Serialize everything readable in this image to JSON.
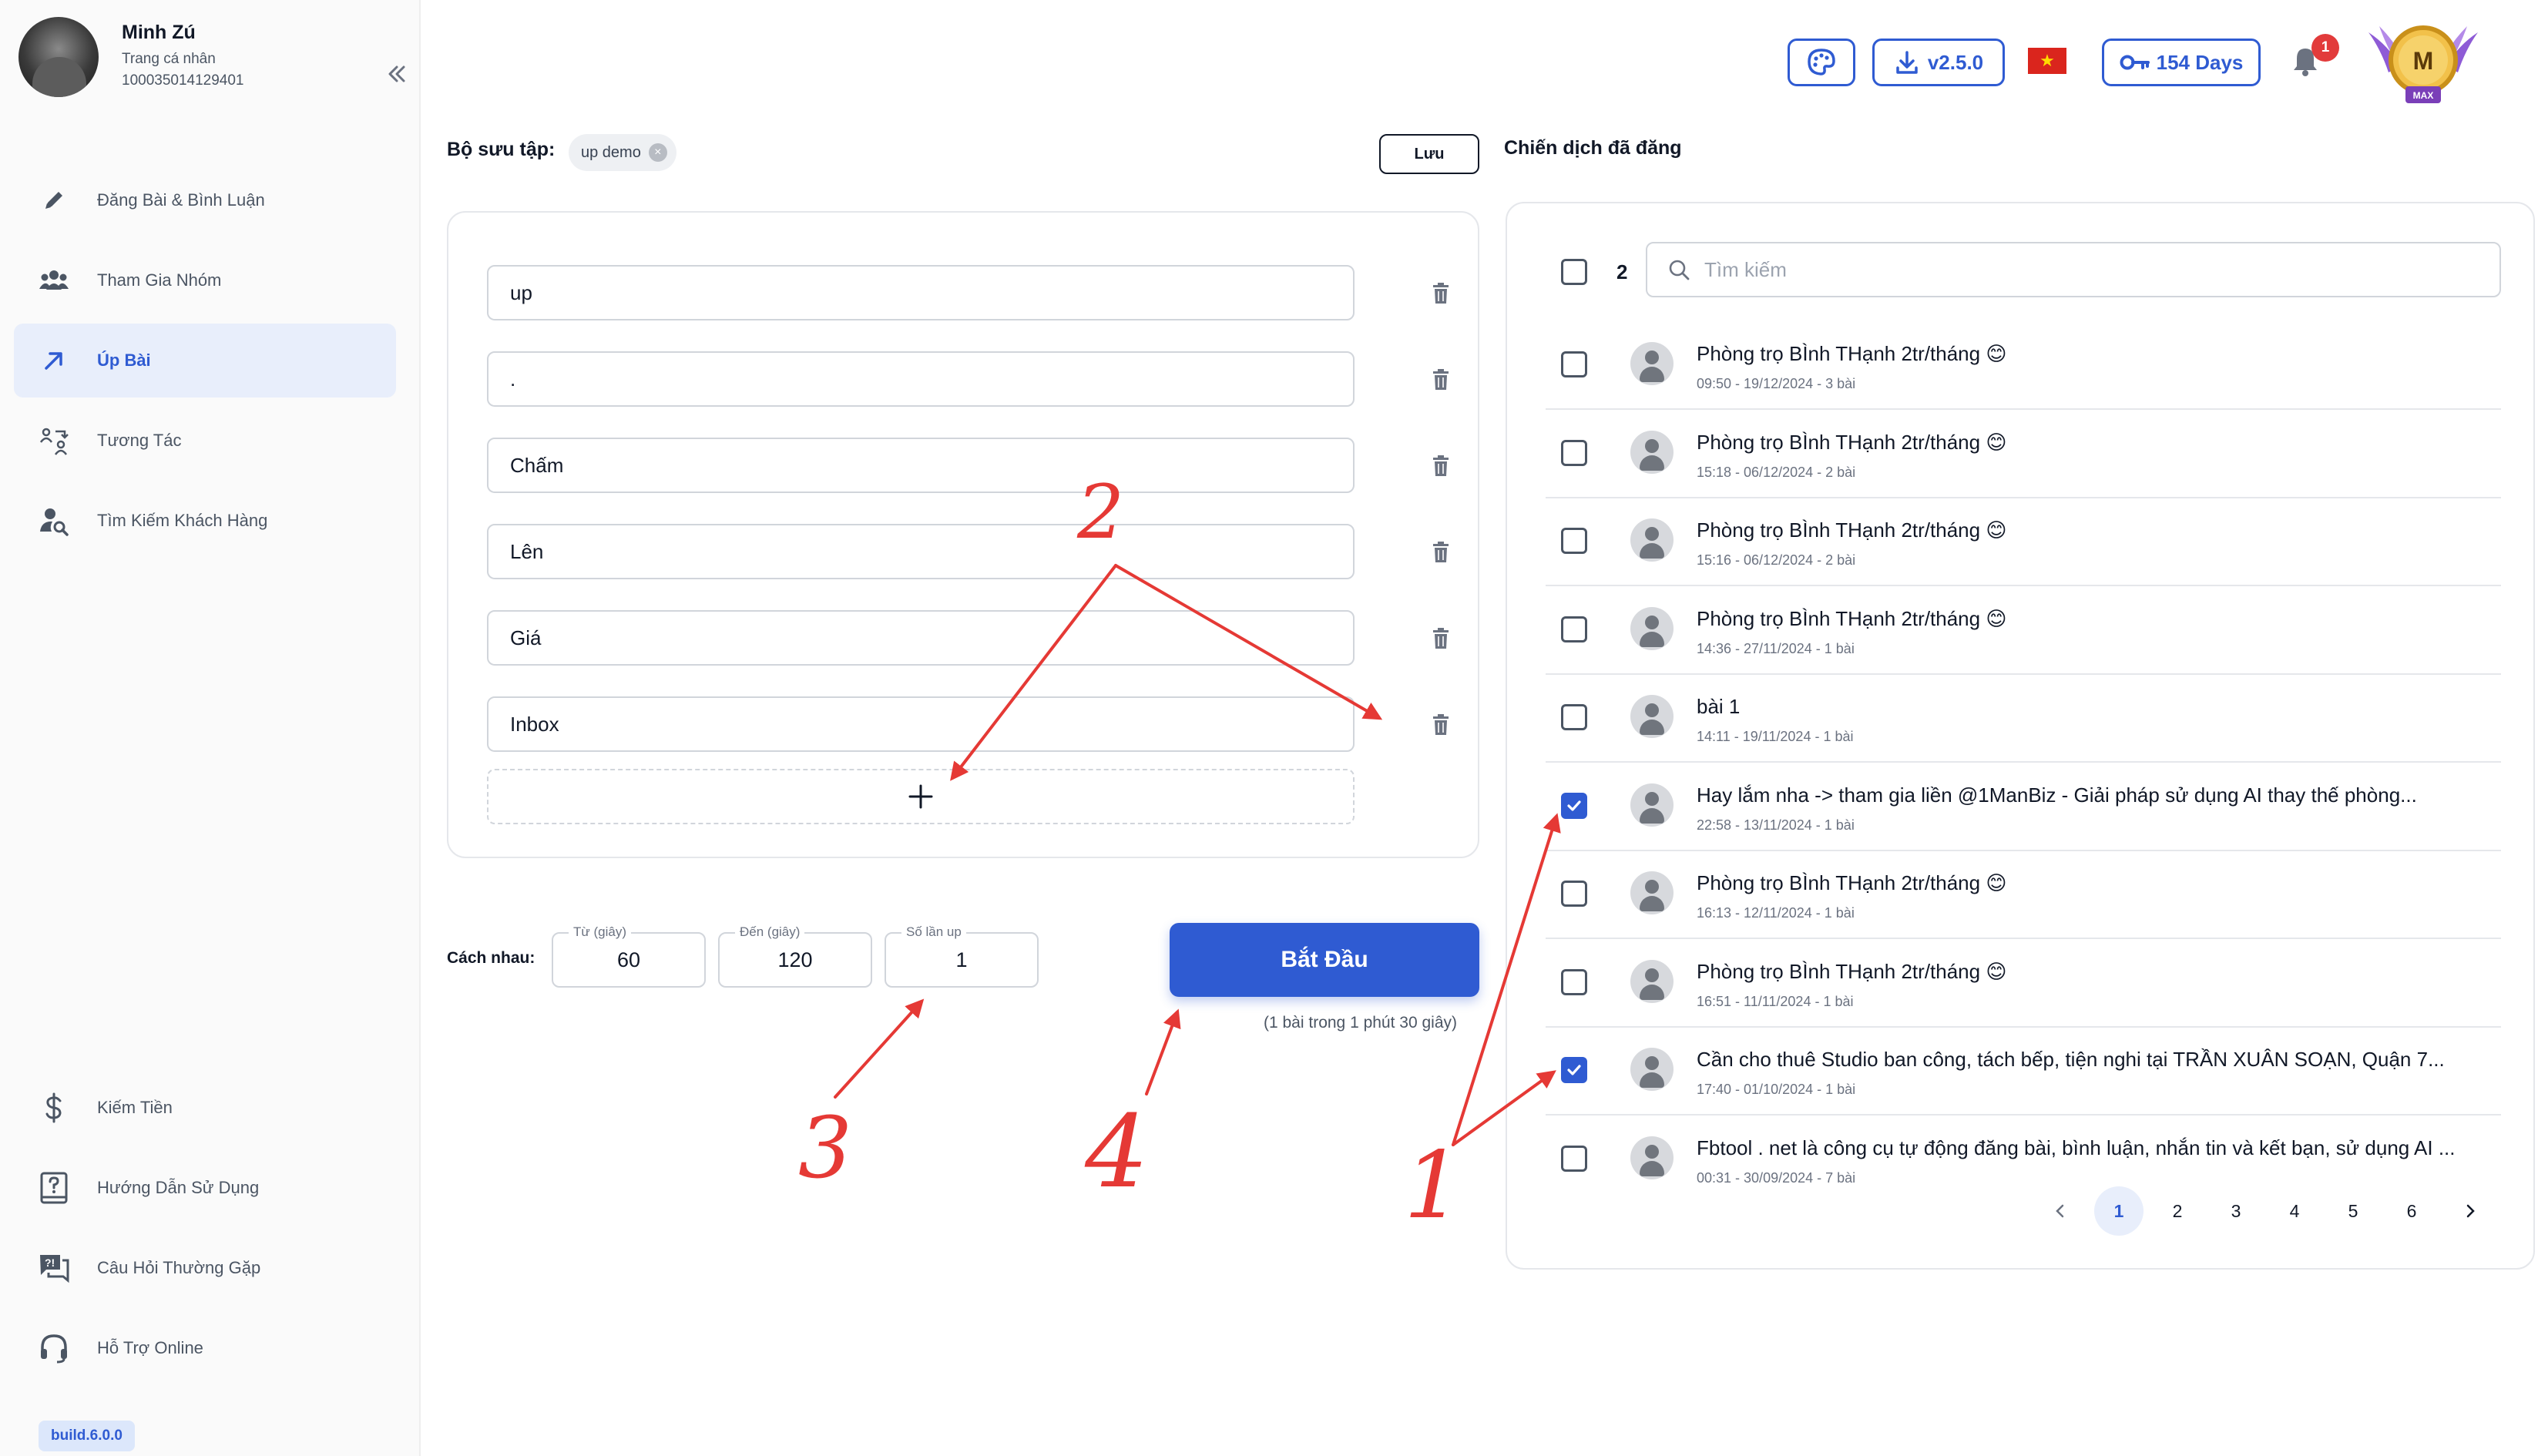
{
  "profile": {
    "name": "Minh Zú",
    "subtitle": "Trang cá nhân",
    "id": "100035014129401"
  },
  "nav": {
    "items": [
      {
        "label": "Đăng Bài & Bình Luận",
        "icon": "pencil-icon"
      },
      {
        "label": "Tham Gia Nhóm",
        "icon": "users-icon"
      },
      {
        "label": "Úp Bài",
        "icon": "arrow-up-right-icon",
        "active": true
      },
      {
        "label": "Tương Tác",
        "icon": "interaction-icon"
      },
      {
        "label": "Tìm Kiếm Khách Hàng",
        "icon": "user-search-icon"
      }
    ],
    "bottom_items": [
      {
        "label": "Kiếm Tiền",
        "icon": "dollar-icon"
      },
      {
        "label": "Hướng Dẫn Sử Dụng",
        "icon": "help-book-icon"
      },
      {
        "label": "Câu Hỏi Thường Gặp",
        "icon": "faq-chat-icon"
      },
      {
        "label": "Hỗ Trợ Online",
        "icon": "headset-icon"
      }
    ],
    "build": "build.6.0.0"
  },
  "topbar": {
    "version": "v2.5.0",
    "days": "154 Days",
    "notifications": "1",
    "badge_letter": "M",
    "badge_tier": "MAX",
    "accent": "#2f5bd2"
  },
  "collection": {
    "label": "Bộ sưu tập:",
    "chip": "up demo",
    "save_label": "Lưu",
    "keywords": [
      "up",
      ".",
      "Chấm",
      "Lên",
      "Giá",
      "Inbox"
    ]
  },
  "timing": {
    "label": "Cách nhau:",
    "from_label": "Từ (giây)",
    "from_value": "60",
    "to_label": "Đến (giây)",
    "to_value": "120",
    "times_label": "Số lần up",
    "times_value": "1"
  },
  "start": {
    "label": "Bắt Đầu",
    "hint": "(1 bài trong 1 phút 30 giây)"
  },
  "campaigns": {
    "title": "Chiến dịch đã đăng",
    "selected_count": "2",
    "search_placeholder": "Tìm kiếm",
    "posts": [
      {
        "title": "Phòng trọ BÌnh THạnh 2tr/tháng 😊",
        "meta": "09:50 - 19/12/2024 - 3 bài",
        "checked": false
      },
      {
        "title": "Phòng trọ BÌnh THạnh 2tr/tháng 😊",
        "meta": "15:18 - 06/12/2024 - 2 bài",
        "checked": false
      },
      {
        "title": "Phòng trọ BÌnh THạnh 2tr/tháng 😊",
        "meta": "15:16 - 06/12/2024 - 2 bài",
        "checked": false
      },
      {
        "title": "Phòng trọ BÌnh THạnh 2tr/tháng 😊",
        "meta": "14:36 - 27/11/2024 - 1 bài",
        "checked": false
      },
      {
        "title": "bài 1",
        "meta": "14:11 - 19/11/2024 - 1 bài",
        "checked": false
      },
      {
        "title": "Hay lắm nha -> tham gia liền @1ManBiz - Giải pháp sử dụng AI thay thế phòng...",
        "meta": "22:58 - 13/11/2024 - 1 bài",
        "checked": true
      },
      {
        "title": "Phòng trọ BÌnh THạnh 2tr/tháng 😊",
        "meta": "16:13 - 12/11/2024 - 1 bài",
        "checked": false
      },
      {
        "title": "Phòng trọ BÌnh THạnh 2tr/tháng 😊",
        "meta": "16:51 - 11/11/2024 - 1 bài",
        "checked": false
      },
      {
        "title": "Cần cho thuê Studio ban công, tách bếp, tiện nghi tại TRẦN XUÂN SOẠN, Quận 7...",
        "meta": "17:40 - 01/10/2024 - 1 bài",
        "checked": true
      },
      {
        "title": "Fbtool . net là công cụ tự động đăng bài, bình luận, nhắn tin và kết bạn, sử dụng AI ...",
        "meta": "00:31 - 30/09/2024 - 7 bài",
        "checked": false
      }
    ],
    "pages": [
      "1",
      "2",
      "3",
      "4",
      "5",
      "6"
    ],
    "current_page": "1"
  },
  "annotations": {
    "labels": [
      "1",
      "2",
      "3",
      "4"
    ],
    "color": "#e53935"
  }
}
